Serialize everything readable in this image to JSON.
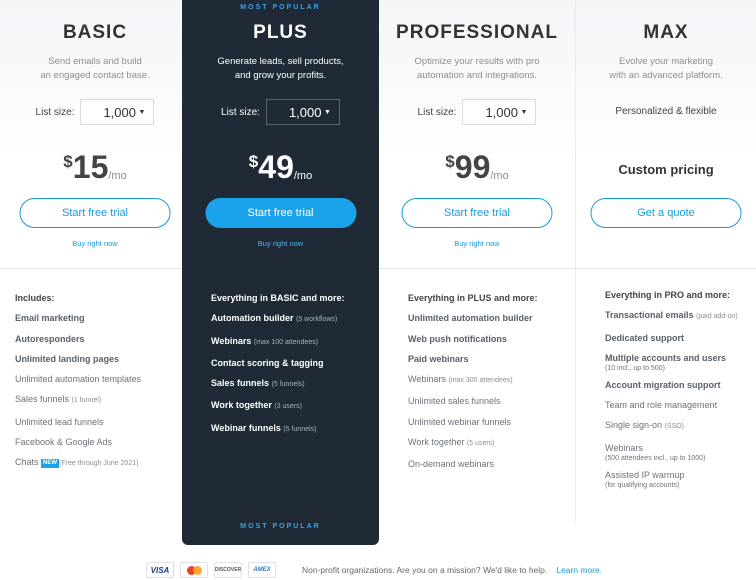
{
  "badge": "MOST POPULAR",
  "list_size_label": "List size:",
  "plans": [
    {
      "name": "BASIC",
      "desc": [
        "Send emails and build",
        "an engaged contact base."
      ],
      "list_size": "1,000",
      "currency": "$",
      "price": "15",
      "per": "/mo",
      "button": "Start free trial",
      "link": "Buy right now",
      "features": [
        {
          "text": "Includes:"
        },
        {
          "text": "Email marketing"
        },
        {
          "text": "Autoresponders"
        },
        {
          "text": "Unlimited landing pages"
        },
        {
          "text": "Unlimited automation templates"
        },
        {
          "text": "Sales funnels",
          "small": "(1 funnel)"
        },
        {
          "text": "Unlimited lead funnels"
        },
        {
          "text": "Facebook & Google Ads"
        },
        {
          "text": "Chats",
          "badge": "NEW",
          "small": "(Free through June 2021)"
        }
      ]
    },
    {
      "name": "PLUS",
      "desc": [
        "Generate leads, sell products,",
        "and grow your profits."
      ],
      "list_size": "1,000",
      "currency": "$",
      "price": "49",
      "per": "/mo",
      "button": "Start free trial",
      "link": "Buy right now",
      "features": [
        {
          "text": "Everything in BASIC and more:"
        },
        {
          "text": "Automation builder",
          "small": "(5 workflows)"
        },
        {
          "text": "Webinars",
          "small": "(max 100 attendees)"
        },
        {
          "text": "Contact scoring & tagging"
        },
        {
          "text": "Sales funnels",
          "small": "(5 funnels)"
        },
        {
          "text": "Work together",
          "small": "(3 users)"
        },
        {
          "text": "Webinar funnels",
          "small": "(5 funnels)"
        }
      ]
    },
    {
      "name": "PROFESSIONAL",
      "desc": [
        "Optimize your results with pro",
        "automation and integrations."
      ],
      "list_size": "1,000",
      "currency": "$",
      "price": "99",
      "per": "/mo",
      "button": "Start free trial",
      "link": "Buy right now",
      "features": [
        {
          "text": "Everything in PLUS and more:"
        },
        {
          "text": "Unlimited automation builder"
        },
        {
          "text": "Web push notifications"
        },
        {
          "text": "Paid webinars"
        },
        {
          "text": "Webinars",
          "small": "(max 300 attendees)"
        },
        {
          "text": "Unlimited sales funnels"
        },
        {
          "text": "Unlimited webinar funnels"
        },
        {
          "text": "Work together",
          "small": "(5 users)"
        },
        {
          "text": "On-demand webinars"
        }
      ]
    },
    {
      "name": "MAX",
      "desc": [
        "Evolve your marketing",
        "with an advanced platform."
      ],
      "flexible": "Personalized & flexible",
      "custom_price": "Custom pricing",
      "button": "Get a quote",
      "features": [
        {
          "text": "Everything in PRO and more:"
        },
        {
          "text": "Transactional emails",
          "small": "(paid add-on)"
        },
        {
          "text": "Dedicated support"
        },
        {
          "text": "Multiple accounts and users",
          "sub": "(10 incl., up to 500)"
        },
        {
          "text": "Account migration support"
        },
        {
          "text": "Team and role management"
        },
        {
          "text": "Single sign-on",
          "small": "(SSO)"
        },
        {
          "text": "Webinars",
          "sub": "(500 attendees incl., up to 1000)"
        },
        {
          "text": "Assisted IP warmup",
          "sub": "(for qualifying accounts)"
        }
      ]
    }
  ],
  "footer": {
    "cards": [
      "VISA",
      "mastercard",
      "DISCOVER",
      "AMEX"
    ],
    "text": "Non-profit organizations. Are you on a mission? We'd like to help.",
    "link": "Learn more."
  }
}
